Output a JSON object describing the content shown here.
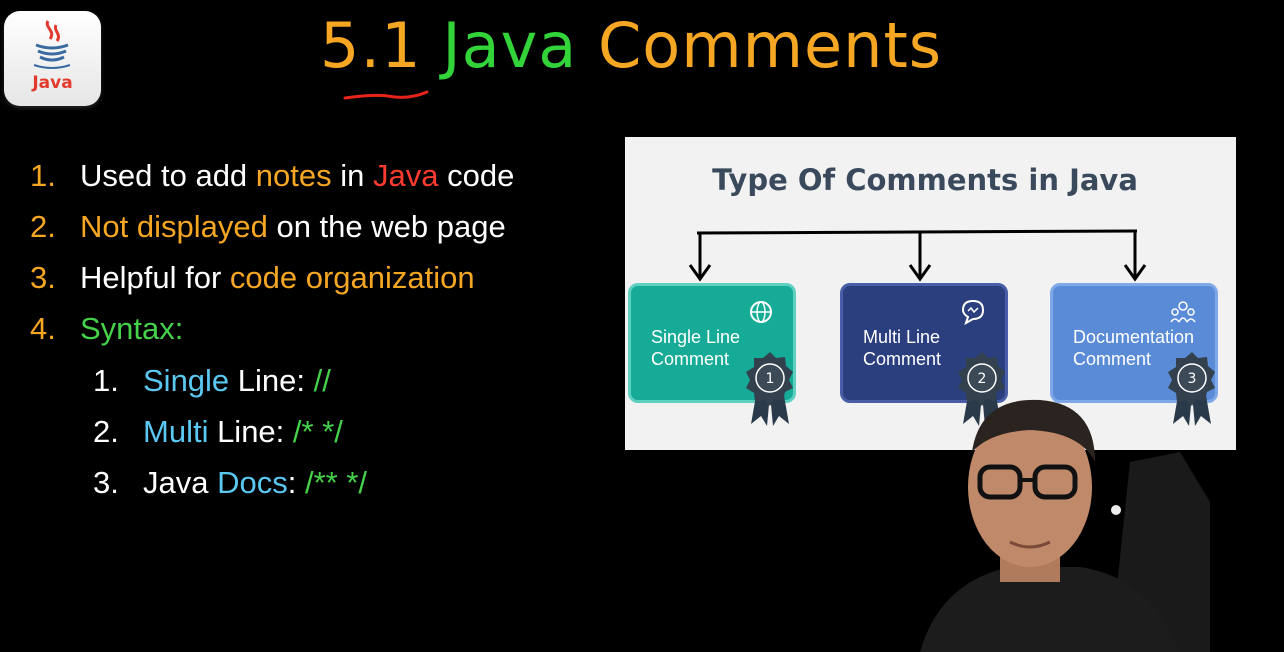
{
  "logo": {
    "text": "Java"
  },
  "title": {
    "number": "5.1",
    "word1": "Java",
    "word2": "Comments"
  },
  "list": {
    "items": [
      {
        "num": "1.",
        "parts": [
          "Used to add ",
          "notes",
          " in ",
          "Java",
          " code"
        ]
      },
      {
        "num": "2.",
        "parts": [
          "Not displayed",
          " on the web page"
        ]
      },
      {
        "num": "3.",
        "parts": [
          "Helpful for ",
          "code organization"
        ]
      },
      {
        "num": "4.",
        "parts": [
          "Syntax:"
        ]
      }
    ],
    "syntax": [
      {
        "num": "1.",
        "parts": [
          "Single",
          " Line: ",
          "//"
        ]
      },
      {
        "num": "2.",
        "parts": [
          "Multi",
          " Line: ",
          "/* */"
        ]
      },
      {
        "num": "3.",
        "parts": [
          "Java ",
          "Docs",
          ": ",
          "/** */"
        ]
      }
    ]
  },
  "slide": {
    "title": "Type Of Comments in Java",
    "cards": [
      {
        "label": "Single Line\nComment",
        "badge": "1",
        "icon": "globe-icon"
      },
      {
        "label": "Multi Line\nComment",
        "badge": "2",
        "icon": "chat-bubble-icon"
      },
      {
        "label": "Documentation\nComment",
        "badge": "3",
        "icon": "people-icon"
      }
    ]
  },
  "colors": {
    "orange": "#f5a623",
    "green": "#32d43a",
    "red": "#ff3b2f",
    "blue": "#5bc8f2"
  }
}
